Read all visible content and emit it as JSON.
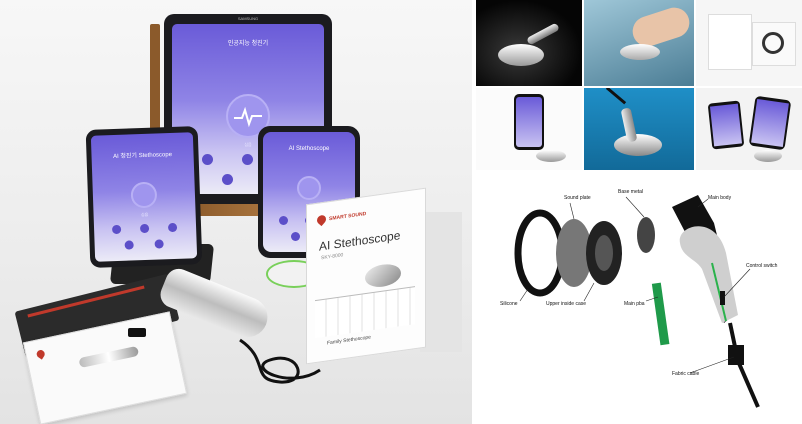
{
  "tablet": {
    "maker": "SAMSUNG",
    "app_title": "인공지능 청진기",
    "heart_label": "심음"
  },
  "phone_left": {
    "app_title": "AI 청진기 Stethoscope",
    "heart_label": "심음"
  },
  "phone_right": {
    "app_title": "AI Stethoscope"
  },
  "product_box": {
    "brand": "SMART SOUND",
    "title": "AI Stethoscope",
    "subtitle": "SKY-8000",
    "tagline": "Family Stethoscope"
  },
  "diagram": {
    "labels": {
      "sound_plate": "Sound plate",
      "base_metal": "Base metal",
      "main_body": "Main body",
      "control_switch": "Control switch",
      "silicone": "Silicone",
      "upper_inside_case": "Upper inside case",
      "main_pba": "Main pba",
      "fabric_cable": "Fabric cable"
    }
  },
  "colors": {
    "app_purple": "#6a5bd8",
    "brand_red": "#c0392b",
    "cable_green": "#2bb24c",
    "blue_photo": "#1f8fc7"
  }
}
